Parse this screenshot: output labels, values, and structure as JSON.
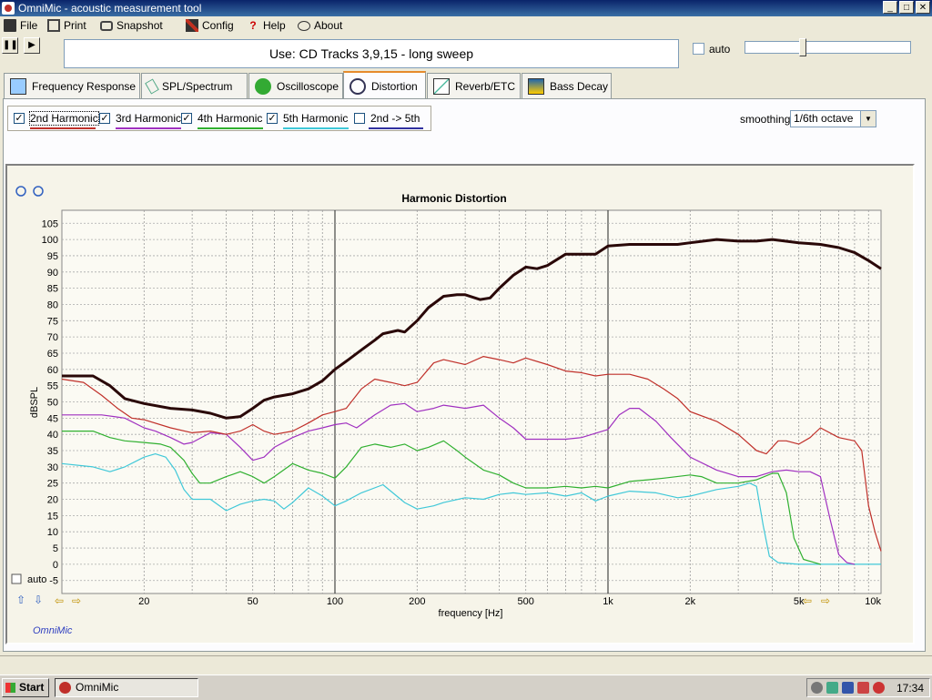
{
  "window": {
    "title": "OmniMic - acoustic measurement tool"
  },
  "menu": [
    {
      "label": "File",
      "icon": "floppy-icon"
    },
    {
      "label": "Print",
      "icon": "printer-icon"
    },
    {
      "label": "Snapshot",
      "icon": "camera-icon"
    },
    {
      "label": "Config",
      "icon": "tools-icon"
    },
    {
      "label": "Help",
      "icon": "help-icon"
    },
    {
      "label": "About",
      "icon": "speech-bubble-icon"
    }
  ],
  "banner": "Use: CD Tracks 3,9,15 - long sweep",
  "auto_top": {
    "label": "auto",
    "checked": false
  },
  "tabs": [
    {
      "label": "Frequency Response",
      "icon": "freq-response-icon",
      "active": false
    },
    {
      "label": "SPL/Spectrum",
      "icon": "spl-meter-icon",
      "active": false
    },
    {
      "label": "Oscilloscope",
      "icon": "oscilloscope-icon",
      "active": false
    },
    {
      "label": "Distortion",
      "icon": "distortion-icon",
      "active": true
    },
    {
      "label": "Reverb/ETC",
      "icon": "reverb-icon",
      "active": false
    },
    {
      "label": "Bass Decay",
      "icon": "bass-decay-icon",
      "active": false
    }
  ],
  "harmonics": [
    {
      "label": "2nd Harmonic",
      "checked": true,
      "color": "#c0302a"
    },
    {
      "label": "3rd Harmonic",
      "checked": true,
      "color": "#a030c0"
    },
    {
      "label": "4th Harmonic",
      "checked": true,
      "color": "#30b030"
    },
    {
      "label": "5th Harmonic",
      "checked": true,
      "color": "#40c8d8"
    },
    {
      "label": "2nd -> 5th",
      "checked": false,
      "color": "#3030a0"
    }
  ],
  "smoothing": {
    "label": "smoothing",
    "value": "1/6th octave"
  },
  "chart_auto": {
    "label": "auto",
    "checked": false
  },
  "brand": "OmniMic",
  "taskbar": {
    "start": "Start",
    "task": "OmniMic",
    "clock": "17:34"
  },
  "chart_data": {
    "type": "line",
    "title": "Harmonic Distortion",
    "xlabel": "frequency [Hz]",
    "ylabel": "dBSPL",
    "x_scale": "log",
    "xlim": [
      10,
      10000
    ],
    "ylim": [
      -9,
      109
    ],
    "grid": true,
    "y_ticks": [
      105,
      100,
      95,
      90,
      85,
      80,
      75,
      70,
      65,
      60,
      55,
      50,
      45,
      40,
      35,
      30,
      25,
      20,
      15,
      10,
      5,
      0,
      -5
    ],
    "x_tick_labels": [
      {
        "x": 20,
        "label": "20"
      },
      {
        "x": 50,
        "label": "50"
      },
      {
        "x": 100,
        "label": "100"
      },
      {
        "x": 200,
        "label": "200"
      },
      {
        "x": 500,
        "label": "500"
      },
      {
        "x": 1000,
        "label": "1k"
      },
      {
        "x": 2000,
        "label": "2k"
      },
      {
        "x": 5000,
        "label": "5k"
      },
      {
        "x": 10000,
        "label": "10k"
      }
    ],
    "series": [
      {
        "color": "#2a0808",
        "width": 3,
        "points": [
          [
            10,
            58
          ],
          [
            13,
            58
          ],
          [
            15,
            55
          ],
          [
            17,
            51
          ],
          [
            20,
            49.5
          ],
          [
            25,
            48
          ],
          [
            30,
            47.5
          ],
          [
            35,
            46.5
          ],
          [
            40,
            45
          ],
          [
            45,
            45.5
          ],
          [
            50,
            48
          ],
          [
            55,
            50.5
          ],
          [
            60,
            51.5
          ],
          [
            70,
            52.5
          ],
          [
            80,
            54
          ],
          [
            90,
            56.5
          ],
          [
            100,
            60
          ],
          [
            110,
            62.5
          ],
          [
            125,
            66
          ],
          [
            140,
            69
          ],
          [
            150,
            71
          ],
          [
            170,
            72
          ],
          [
            180,
            71.5
          ],
          [
            200,
            75
          ],
          [
            220,
            79
          ],
          [
            250,
            82.5
          ],
          [
            280,
            83
          ],
          [
            300,
            83
          ],
          [
            340,
            81.5
          ],
          [
            370,
            82
          ],
          [
            400,
            85
          ],
          [
            450,
            89
          ],
          [
            500,
            91.5
          ],
          [
            550,
            91
          ],
          [
            600,
            92
          ],
          [
            700,
            95.5
          ],
          [
            800,
            95.5
          ],
          [
            900,
            95.5
          ],
          [
            1000,
            98
          ],
          [
            1200,
            98.5
          ],
          [
            1500,
            98.5
          ],
          [
            1800,
            98.5
          ],
          [
            2000,
            99
          ],
          [
            2500,
            100
          ],
          [
            3000,
            99.5
          ],
          [
            3500,
            99.5
          ],
          [
            4000,
            100
          ],
          [
            5000,
            99
          ],
          [
            6000,
            98.5
          ],
          [
            7000,
            97.5
          ],
          [
            8000,
            96
          ],
          [
            9000,
            93.5
          ],
          [
            10000,
            91
          ]
        ]
      },
      {
        "color": "#c0302a",
        "width": 1.2,
        "points": [
          [
            10,
            57
          ],
          [
            12,
            56
          ],
          [
            14,
            52
          ],
          [
            16,
            48
          ],
          [
            18,
            45
          ],
          [
            20,
            44.5
          ],
          [
            25,
            42
          ],
          [
            30,
            40.5
          ],
          [
            35,
            41
          ],
          [
            40,
            40
          ],
          [
            45,
            41
          ],
          [
            50,
            43
          ],
          [
            55,
            41
          ],
          [
            60,
            40
          ],
          [
            70,
            41
          ],
          [
            80,
            43.5
          ],
          [
            90,
            46
          ],
          [
            100,
            47
          ],
          [
            110,
            48
          ],
          [
            125,
            54
          ],
          [
            140,
            57
          ],
          [
            160,
            56
          ],
          [
            180,
            55
          ],
          [
            200,
            56
          ],
          [
            230,
            62
          ],
          [
            250,
            63
          ],
          [
            300,
            61.5
          ],
          [
            350,
            64
          ],
          [
            400,
            63
          ],
          [
            450,
            62
          ],
          [
            500,
            63.5
          ],
          [
            600,
            61.5
          ],
          [
            700,
            59.5
          ],
          [
            800,
            59
          ],
          [
            900,
            58
          ],
          [
            1000,
            58.5
          ],
          [
            1200,
            58.5
          ],
          [
            1400,
            57
          ],
          [
            1600,
            54
          ],
          [
            1800,
            51
          ],
          [
            2000,
            47
          ],
          [
            2500,
            44
          ],
          [
            3000,
            40
          ],
          [
            3500,
            35
          ],
          [
            3800,
            34
          ],
          [
            4200,
            38
          ],
          [
            4500,
            38
          ],
          [
            5000,
            37
          ],
          [
            5500,
            39
          ],
          [
            6000,
            42
          ],
          [
            7000,
            39
          ],
          [
            8000,
            38
          ],
          [
            8500,
            35
          ],
          [
            9000,
            18
          ],
          [
            9500,
            10
          ],
          [
            10000,
            4
          ]
        ]
      },
      {
        "color": "#a030c0",
        "width": 1.2,
        "points": [
          [
            10,
            46
          ],
          [
            14,
            46
          ],
          [
            17,
            45
          ],
          [
            20,
            42
          ],
          [
            22,
            41
          ],
          [
            25,
            39
          ],
          [
            28,
            37
          ],
          [
            30,
            37.5
          ],
          [
            35,
            40.5
          ],
          [
            40,
            40
          ],
          [
            45,
            36
          ],
          [
            50,
            32
          ],
          [
            55,
            33
          ],
          [
            60,
            36
          ],
          [
            70,
            39
          ],
          [
            80,
            41
          ],
          [
            90,
            42
          ],
          [
            100,
            43
          ],
          [
            110,
            43.5
          ],
          [
            120,
            42
          ],
          [
            140,
            46
          ],
          [
            160,
            49
          ],
          [
            180,
            49.5
          ],
          [
            200,
            47
          ],
          [
            230,
            48
          ],
          [
            250,
            49
          ],
          [
            300,
            48
          ],
          [
            350,
            49
          ],
          [
            400,
            45
          ],
          [
            450,
            42
          ],
          [
            500,
            38.5
          ],
          [
            600,
            38.5
          ],
          [
            700,
            38.5
          ],
          [
            800,
            39
          ],
          [
            1000,
            41.5
          ],
          [
            1100,
            46
          ],
          [
            1200,
            48
          ],
          [
            1300,
            48
          ],
          [
            1500,
            44
          ],
          [
            1700,
            39
          ],
          [
            2000,
            33
          ],
          [
            2500,
            29
          ],
          [
            3000,
            27
          ],
          [
            3500,
            27
          ],
          [
            4000,
            28.5
          ],
          [
            4500,
            29
          ],
          [
            5000,
            28.5
          ],
          [
            5500,
            28.5
          ],
          [
            6000,
            27
          ],
          [
            6500,
            14
          ],
          [
            7000,
            3
          ],
          [
            7500,
            0.5
          ],
          [
            8000,
            0
          ]
        ]
      },
      {
        "color": "#30b030",
        "width": 1.2,
        "points": [
          [
            10,
            41
          ],
          [
            13,
            41
          ],
          [
            15,
            39
          ],
          [
            17,
            38
          ],
          [
            20,
            37.5
          ],
          [
            23,
            37
          ],
          [
            25,
            36
          ],
          [
            28,
            32
          ],
          [
            30,
            28
          ],
          [
            32,
            25
          ],
          [
            35,
            25
          ],
          [
            40,
            27
          ],
          [
            45,
            28.5
          ],
          [
            50,
            27
          ],
          [
            55,
            25
          ],
          [
            60,
            27
          ],
          [
            70,
            31
          ],
          [
            80,
            29
          ],
          [
            90,
            28
          ],
          [
            100,
            26.5
          ],
          [
            110,
            30
          ],
          [
            125,
            36
          ],
          [
            140,
            37
          ],
          [
            160,
            36
          ],
          [
            180,
            37
          ],
          [
            200,
            35
          ],
          [
            220,
            36
          ],
          [
            250,
            38
          ],
          [
            280,
            35
          ],
          [
            300,
            33
          ],
          [
            350,
            29
          ],
          [
            400,
            27.5
          ],
          [
            450,
            25
          ],
          [
            500,
            23.5
          ],
          [
            600,
            23.5
          ],
          [
            700,
            24
          ],
          [
            800,
            23.5
          ],
          [
            900,
            24
          ],
          [
            1000,
            23.5
          ],
          [
            1200,
            25.5
          ],
          [
            1400,
            26
          ],
          [
            1600,
            26.5
          ],
          [
            2000,
            27.5
          ],
          [
            2200,
            27
          ],
          [
            2500,
            25
          ],
          [
            3000,
            25
          ],
          [
            3500,
            26
          ],
          [
            4000,
            28
          ],
          [
            4200,
            28
          ],
          [
            4500,
            22
          ],
          [
            4800,
            8
          ],
          [
            5200,
            1.5
          ],
          [
            6000,
            0
          ]
        ]
      },
      {
        "color": "#40c8d8",
        "width": 1.2,
        "points": [
          [
            10,
            31
          ],
          [
            13,
            30
          ],
          [
            15,
            28.5
          ],
          [
            17,
            30
          ],
          [
            20,
            33
          ],
          [
            22,
            34
          ],
          [
            24,
            33
          ],
          [
            26,
            29
          ],
          [
            28,
            23
          ],
          [
            30,
            20
          ],
          [
            35,
            20
          ],
          [
            40,
            16.5
          ],
          [
            45,
            18.5
          ],
          [
            50,
            19.5
          ],
          [
            55,
            20
          ],
          [
            60,
            19.5
          ],
          [
            65,
            17
          ],
          [
            70,
            19
          ],
          [
            80,
            23.5
          ],
          [
            90,
            21
          ],
          [
            100,
            18
          ],
          [
            110,
            19.5
          ],
          [
            125,
            22
          ],
          [
            150,
            24.5
          ],
          [
            180,
            19
          ],
          [
            200,
            17
          ],
          [
            230,
            18
          ],
          [
            250,
            19
          ],
          [
            300,
            20.5
          ],
          [
            350,
            20
          ],
          [
            400,
            21.5
          ],
          [
            450,
            22
          ],
          [
            500,
            21.5
          ],
          [
            600,
            22
          ],
          [
            700,
            21
          ],
          [
            800,
            22
          ],
          [
            900,
            19.5
          ],
          [
            1000,
            21
          ],
          [
            1200,
            22.5
          ],
          [
            1500,
            22
          ],
          [
            1800,
            20.5
          ],
          [
            2000,
            21
          ],
          [
            2500,
            23
          ],
          [
            3000,
            24
          ],
          [
            3300,
            25
          ],
          [
            3500,
            24
          ],
          [
            3700,
            12
          ],
          [
            3900,
            2.5
          ],
          [
            4200,
            0.5
          ],
          [
            5000,
            0
          ],
          [
            10000,
            0
          ]
        ]
      }
    ]
  }
}
